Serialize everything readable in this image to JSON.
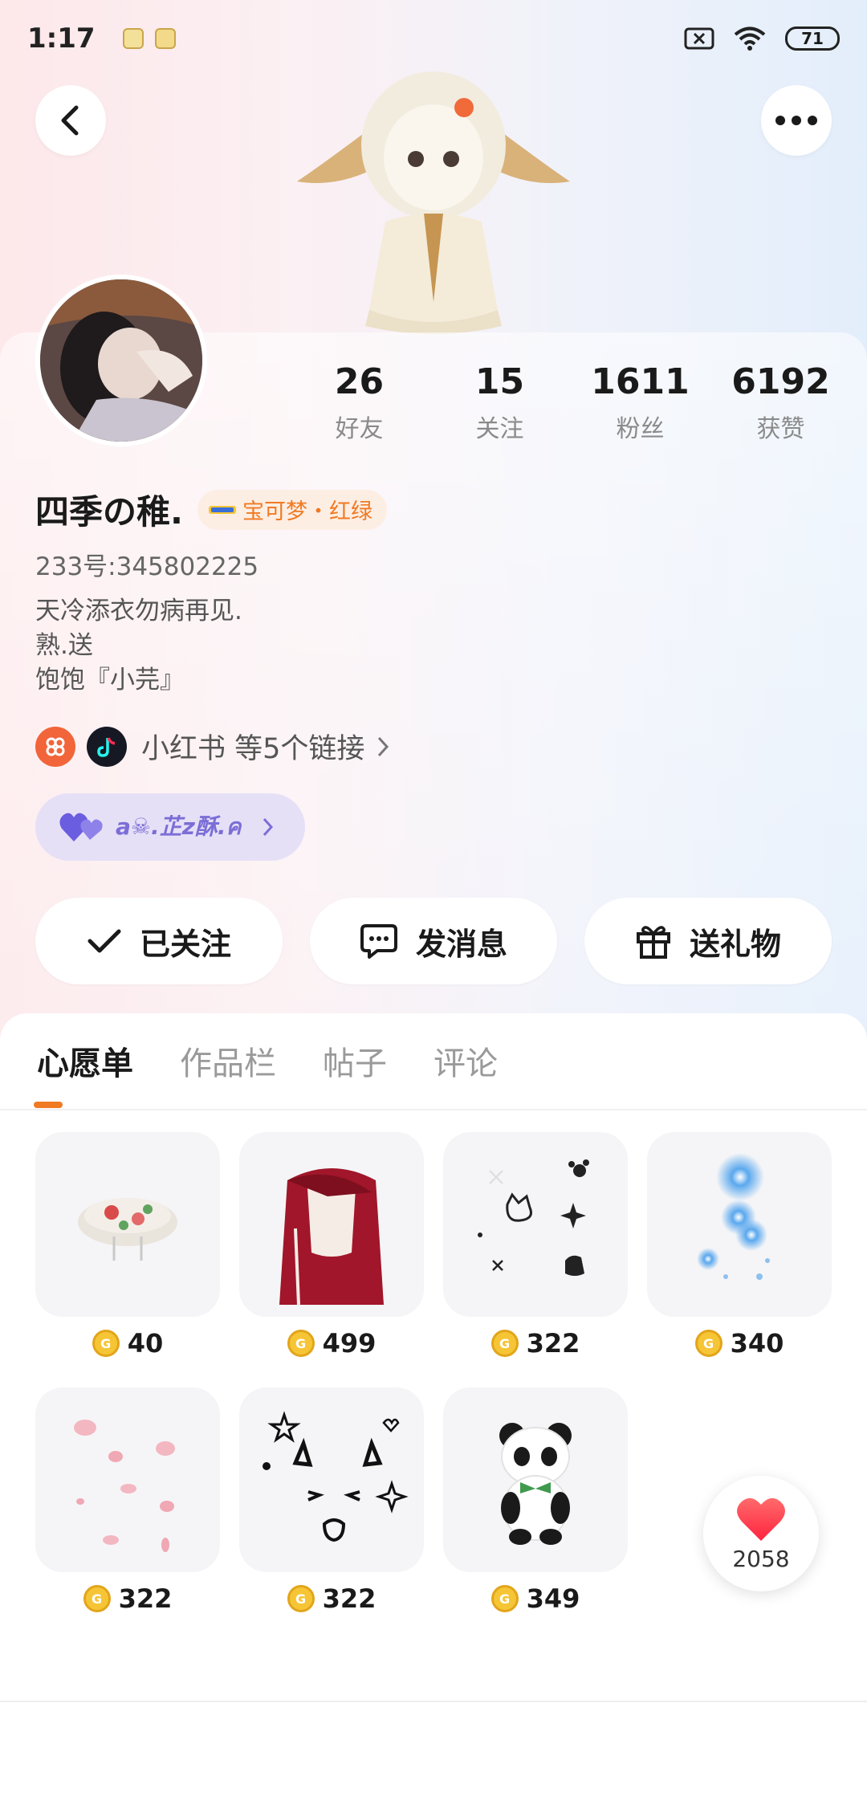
{
  "status_bar": {
    "time": "1:17",
    "battery": "71"
  },
  "icons": {
    "back": "chevron-left-icon",
    "more": "more-dots-icon",
    "wifi": "wifi-icon",
    "sim": "sim-x-icon",
    "heart": "heart-icon",
    "coin": "coin-icon"
  },
  "profile": {
    "username": "四季の稚.",
    "tag": "宝可梦・红绿",
    "uid": "233号:345802225",
    "bio": [
      "天冷添衣勿病再见.",
      "熟.送",
      "饱饱『小芫』"
    ],
    "links_text": "小红书 等5个链接",
    "fan_badge": "a☠.芷z酥.ค"
  },
  "stats": [
    {
      "value": "26",
      "label": "好友"
    },
    {
      "value": "15",
      "label": "关注"
    },
    {
      "value": "1611",
      "label": "粉丝"
    },
    {
      "value": "6192",
      "label": "获赞"
    }
  ],
  "actions": {
    "follow": "已关注",
    "message": "发消息",
    "gift": "送礼物"
  },
  "tabs": [
    "心愿单",
    "作品栏",
    "帖子",
    "评论"
  ],
  "wishlist": [
    {
      "name": "floral-beret",
      "price": "40"
    },
    {
      "name": "red-long-hair",
      "price": "499"
    },
    {
      "name": "cat-doodle-stickers",
      "price": "322"
    },
    {
      "name": "blue-glow-effect",
      "price": "340"
    },
    {
      "name": "petal-effect",
      "price": "322"
    },
    {
      "name": "cat-face-sketch",
      "price": "322"
    },
    {
      "name": "panda-plush",
      "price": "349"
    }
  ],
  "like_float": {
    "count": "2058"
  },
  "colors": {
    "accent": "#f07a22",
    "fan_purple": "#7b6ed6",
    "heart": "#ff3b4f",
    "coin": "#f6c536"
  }
}
